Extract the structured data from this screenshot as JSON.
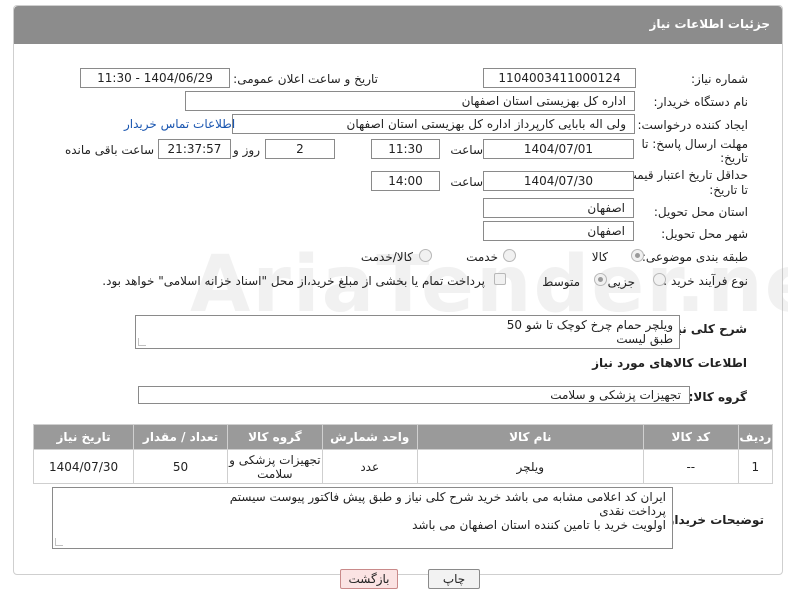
{
  "header": {
    "title": "جزئیات اطلاعات نیاز"
  },
  "fields": {
    "need_number": {
      "label": "شماره نیاز:",
      "value": "1104003411000124"
    },
    "announce": {
      "label": "تاریخ و ساعت اعلان عمومی:",
      "value": "1404/06/29 - 11:30"
    },
    "buyer_org": {
      "label": "نام دستگاه خریدار:",
      "value": "اداره کل بهزیستی استان اصفهان"
    },
    "requester": {
      "label": "ایجاد کننده درخواست:",
      "value": "ولی اله بابایی کارپرداز اداره کل بهزیستی استان اصفهان",
      "contact_link": "اطلاعات تماس خریدار"
    },
    "reply_deadline": {
      "label_line1": "مهلت ارسال پاسخ: تا",
      "label_line2": "تاریخ:",
      "date": "1404/07/01",
      "time_label": "ساعت",
      "time": "11:30",
      "days": "2",
      "days_label": "روز و",
      "remaining": "21:37:57",
      "remaining_label": "ساعت باقی مانده"
    },
    "price_validity": {
      "label_line1": "حداقل تاریخ اعتبار قیمت:",
      "label_line2": "تا تاریخ:",
      "date": "1404/07/30",
      "time_label": "ساعت",
      "time": "14:00"
    },
    "province": {
      "label": "استان محل تحویل:",
      "value": "اصفهان"
    },
    "city": {
      "label": "شهر محل تحویل:",
      "value": "اصفهان"
    },
    "category": {
      "label": "طبقه بندی موضوعی:",
      "options": [
        "کالا",
        "خدمت",
        "کالا/خدمت"
      ],
      "selected": "کالا"
    },
    "process": {
      "label": "نوع فرآیند خرید :",
      "options": [
        "جزیی",
        "متوسط"
      ],
      "selected": "متوسط",
      "note": "پرداخت تمام یا بخشی از مبلغ خرید،از محل \"اسناد خزانه اسلامی\" خواهد بود."
    }
  },
  "description": {
    "label": "شرح کلی نیاز:",
    "lines": [
      "ویلچر حمام چرخ کوچک تا شو 50",
      "طبق لیست"
    ]
  },
  "goods_info": {
    "title": "اطلاعات کالاهای مورد نیاز",
    "group_label": "گروه کالا:",
    "group_value": "تجهیزات پزشکی و سلامت"
  },
  "table": {
    "headers": [
      "ردیف",
      "کد کالا",
      "نام کالا",
      "واحد شمارش",
      "گروه کالا",
      "تعداد / مقدار",
      "تاریخ نیاز"
    ],
    "rows": [
      {
        "row": "1",
        "code": "--",
        "name": "ویلچر",
        "unit": "عدد",
        "group_l1": "تجهیزات پزشکی و",
        "group_l2": "سلامت",
        "qty": "50",
        "date": "1404/07/30"
      }
    ]
  },
  "buyer_notes": {
    "label": "توضیحات خریدار:",
    "lines": [
      "ایران کد اعلامی مشابه می باشد خرید شرح کلی نیاز و طبق پیش فاکتور پیوست سیستم",
      "پرداخت نقدی",
      "اولویت خرید با تامین کننده استان اصفهان  می باشد"
    ]
  },
  "buttons": {
    "print": "چاپ",
    "back": "بازگشت"
  },
  "watermark": "AriaTender.neT",
  "colors": {
    "header_bg": "#8c8c8c",
    "table_header_bg": "#9a9a9a",
    "link": "#1a56b0",
    "back_button_bg": "#fbe3e3"
  }
}
